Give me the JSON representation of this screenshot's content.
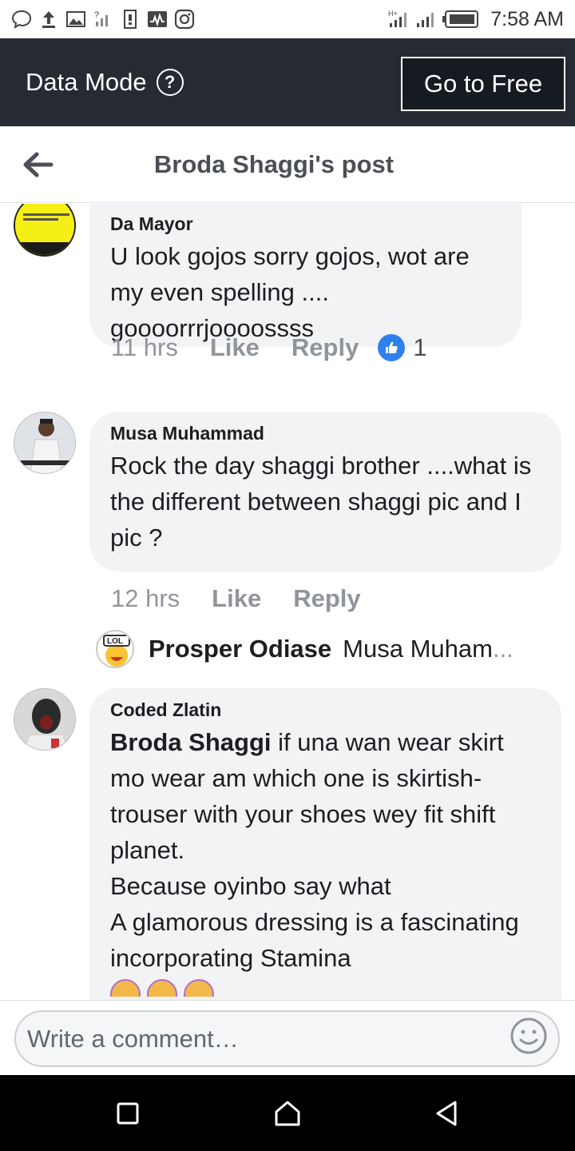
{
  "status_bar": {
    "time": "7:58 AM",
    "left_icons": [
      "chat-bubble-icon",
      "upload-icon",
      "image-icon",
      "no-signal-icon",
      "sim-icon",
      "activity-icon",
      "instagram-icon"
    ],
    "right_icons": [
      "signal-h-icon",
      "signal-icon",
      "battery-icon"
    ]
  },
  "data_bar": {
    "title": "Data Mode",
    "help_icon": "?",
    "go_free_label": "Go to Free"
  },
  "title_bar": {
    "title": "Broda Shaggi's post"
  },
  "comments": [
    {
      "author": "Da Mayor",
      "text": "U look gojos sorry gojos, wot are my even spelling ....\ngoooorrrjoooossss",
      "time": "11 hrs",
      "like": "Like",
      "reply": "Reply",
      "reaction_count": "1"
    },
    {
      "author": "Musa Muhammad",
      "text": "Rock the day shaggi brother ....what is the different between shaggi pic and I pic ?",
      "time": "12 hrs",
      "like": "Like",
      "reply": "Reply"
    },
    {
      "author": "Coded Zlatin",
      "mention": "Broda Shaggi",
      "text": " if una wan wear skirt mo wear am which one is skirtish-trouser with your shoes wey fit shift planet.\nBecause oyinbo say what\nA glamorous dressing is a fascinating incorporating Stamina"
    }
  ],
  "reply_preview": {
    "avatar_label": "LOL",
    "name": "Prosper Odiase",
    "text": "Musa Muham",
    "ellipsis": "..."
  },
  "composer": {
    "placeholder": "Write a comment…"
  },
  "nav_bar": {
    "buttons": [
      "recents-square-icon",
      "home-icon",
      "back-triangle-icon"
    ]
  },
  "colors": {
    "data_bar_bg": "#252a33",
    "bubble_bg": "#f2f3f5",
    "like_blue": "#2f80ed",
    "meta_gray": "#90949c"
  }
}
